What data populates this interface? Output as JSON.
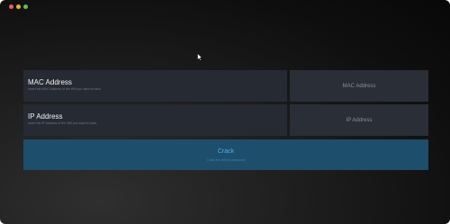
{
  "form": {
    "mac": {
      "title": "MAC Address",
      "description": "Insert the MAC Address of the Wifi you want to hack.",
      "placeholder": "MAC Address"
    },
    "ip": {
      "title": "IP Address",
      "description": "Insert the IP Address of the Wifi you want to hack.",
      "placeholder": "IP Address"
    }
  },
  "crack": {
    "label": "Crack",
    "subtitle": "Crack the Wifi by password"
  },
  "colors": {
    "accent": "#4cb0e2",
    "button_bg": "#1d4e6c",
    "panel_bg": "#262a32"
  }
}
